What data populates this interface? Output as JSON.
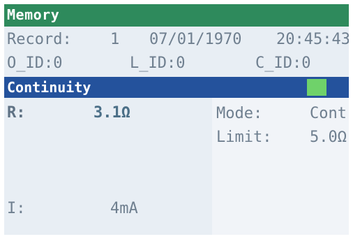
{
  "header": {
    "title": "Memory"
  },
  "record": {
    "label": "Record:",
    "number": "1",
    "date": "07/01/1970",
    "time": "20:45:43"
  },
  "ids": {
    "o_id": "O_ID:0",
    "l_id": "L_ID:0",
    "c_id": "C_ID:0"
  },
  "test": {
    "name": "Continuity",
    "indicator_color": "#6fd26a"
  },
  "result": {
    "r_label": "R:",
    "r_value": "3.1Ω",
    "i_label": "I:",
    "i_value": "4mA"
  },
  "settings": {
    "mode_label": "Mode:",
    "mode_value": "Cont",
    "limit_label": "Limit:",
    "limit_value": "5.0Ω"
  }
}
